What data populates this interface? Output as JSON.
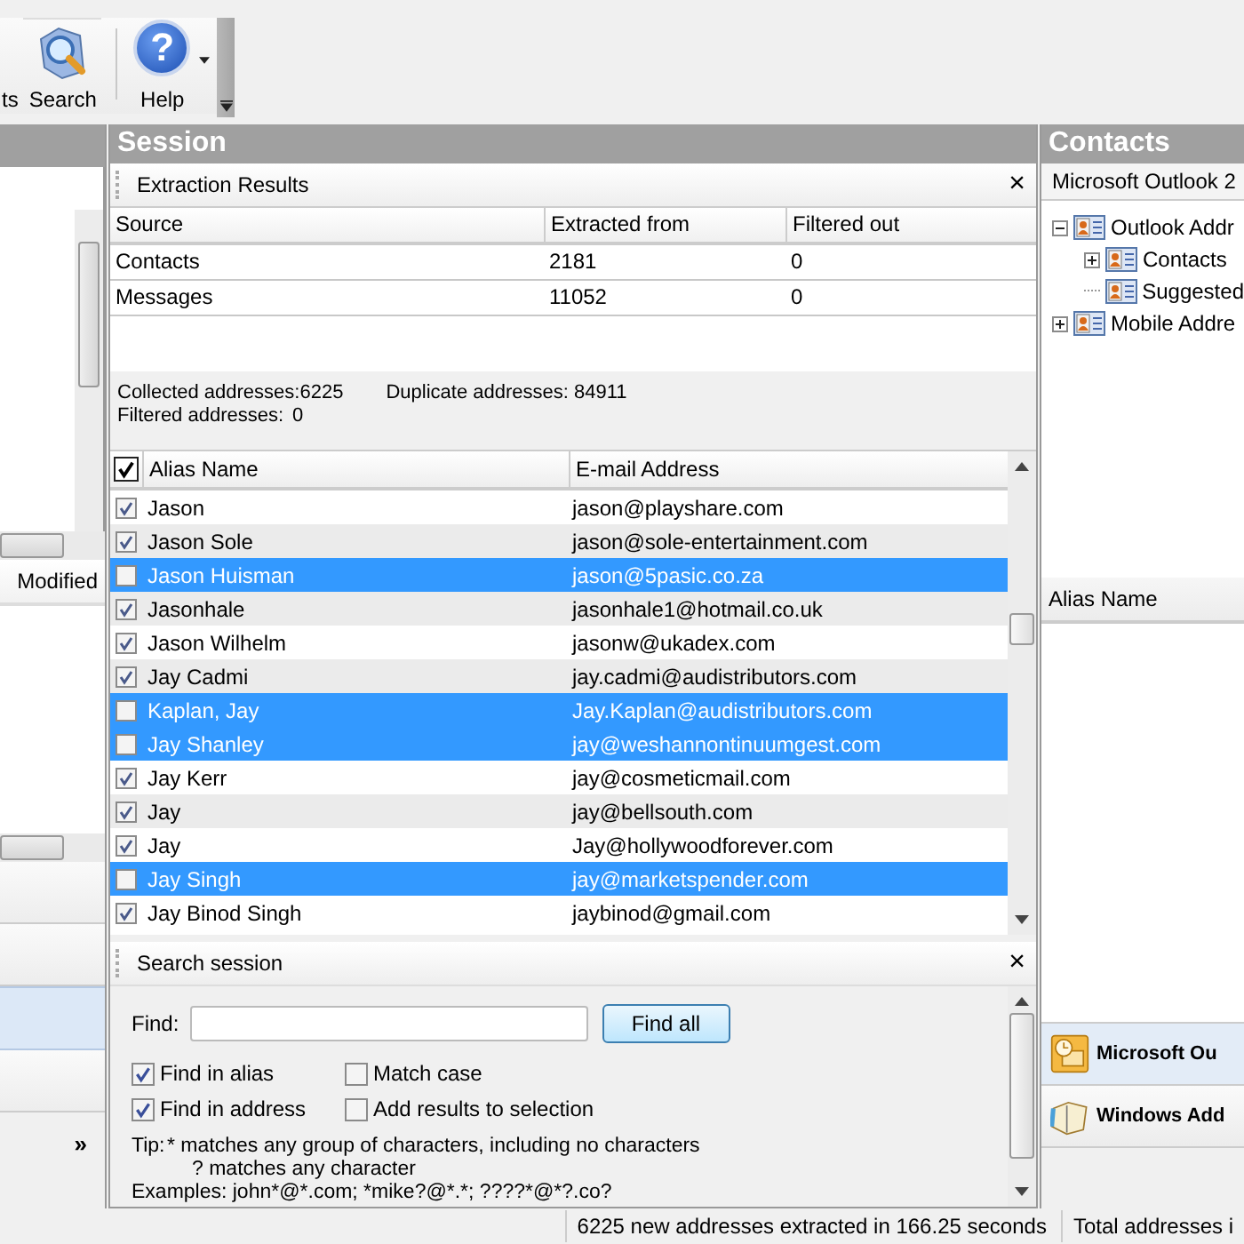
{
  "toolbar": {
    "buttons": [
      {
        "kind": "cut",
        "label": "ts",
        "dropdown": false
      },
      {
        "kind": "search",
        "label": "Search",
        "dropdown": false
      },
      {
        "kind": "help",
        "label": "Help",
        "glyph": "?",
        "dropdown": true
      }
    ]
  },
  "left_panel": {
    "column_header": "Modified",
    "nav_items": [
      {
        "selected": false
      },
      {
        "selected": false
      },
      {
        "selected": true
      },
      {
        "selected": false
      }
    ],
    "more_glyph": "»"
  },
  "session": {
    "title": "Session",
    "extraction": {
      "title": "Extraction Results",
      "close": "×",
      "columns": [
        "Source",
        "Extracted from",
        "Filtered out"
      ],
      "rows": [
        [
          "Contacts",
          "2181",
          "0"
        ],
        [
          "Messages",
          "11052",
          "0"
        ]
      ]
    },
    "stats": {
      "collected_label": "Collected addresses:",
      "collected": "6225",
      "duplicate_label": "Duplicate addresses:",
      "duplicate": "84911",
      "filtered_label": "Filtered addresses:",
      "filtered": "0"
    },
    "addresses": {
      "all_checked": true,
      "columns": [
        "Alias Name",
        "E-mail Address"
      ],
      "rows": [
        {
          "alias": "Jason",
          "email": "jason@playshare.com",
          "checked": true,
          "selected": false
        },
        {
          "alias": "Jason Sole",
          "email": "jason@sole-entertainment.com",
          "checked": true,
          "selected": false
        },
        {
          "alias": "Jason Huisman",
          "email": "jason@5pasic.co.za",
          "checked": false,
          "selected": true
        },
        {
          "alias": "Jasonhale",
          "email": "jasonhale1@hotmail.co.uk",
          "checked": true,
          "selected": false
        },
        {
          "alias": "Jason Wilhelm",
          "email": "jasonw@ukadex.com",
          "checked": true,
          "selected": false
        },
        {
          "alias": "Jay Cadmi",
          "email": "jay.cadmi@audistributors.com",
          "checked": true,
          "selected": false
        },
        {
          "alias": "Kaplan, Jay",
          "email": "Jay.Kaplan@audistributors.com",
          "checked": false,
          "selected": true
        },
        {
          "alias": "Jay Shanley",
          "email": "jay@weshannontinuumgest.com",
          "checked": false,
          "selected": true
        },
        {
          "alias": "Jay Kerr",
          "email": "jay@cosmeticmail.com",
          "checked": true,
          "selected": false
        },
        {
          "alias": "Jay",
          "email": "jay@bellsouth.com",
          "checked": true,
          "selected": false
        },
        {
          "alias": "Jay",
          "email": "Jay@hollywoodforever.com",
          "checked": true,
          "selected": false
        },
        {
          "alias": "Jay Singh",
          "email": "jay@marketspender.com",
          "checked": false,
          "selected": true
        },
        {
          "alias": "Jay Binod Singh",
          "email": "jaybinod@gmail.com",
          "checked": true,
          "selected": false
        }
      ]
    },
    "search": {
      "title": "Search session",
      "close": "×",
      "find_label": "Find:",
      "find_button": "Find all",
      "options": [
        {
          "label": "Find in alias",
          "checked": true
        },
        {
          "label": "Match case",
          "checked": false
        },
        {
          "label": "Find in address",
          "checked": true
        },
        {
          "label": "Add results to selection",
          "checked": false
        }
      ],
      "tip_label": "Tip:",
      "tip_lines": [
        "* matches any group of characters, including no characters",
        "? matches any character"
      ],
      "examples": "Examples: john*@*.com; *mike?@*.*; ????*@*?.co?"
    }
  },
  "contacts": {
    "title": "Contacts",
    "source": "Microsoft Outlook 2",
    "tree": [
      {
        "label": "Outlook Addr",
        "expanded": true,
        "children": [
          {
            "label": "Contacts",
            "expanded": false,
            "expandable": true
          },
          {
            "label": "Suggested"
          }
        ]
      },
      {
        "label": "Mobile Addre",
        "expanded": false,
        "expandable": true
      }
    ],
    "column_header": "Alias Name",
    "nav_items": [
      {
        "kind": "outlook",
        "label": "Microsoft Ou",
        "selected": true
      },
      {
        "kind": "book",
        "label": "Windows Add",
        "selected": false
      }
    ]
  },
  "status_bar": [
    "6225 new addresses extracted in 166.25 seconds",
    "Total addresses i"
  ]
}
